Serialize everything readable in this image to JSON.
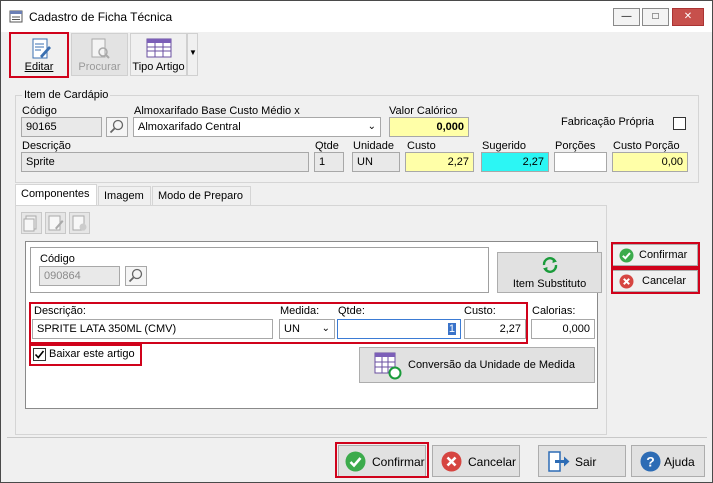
{
  "window": {
    "title": "Cadastro de Ficha Técnica"
  },
  "toolbar": {
    "edit_label": "Editar",
    "search_label": "Procurar",
    "type_label": "Tipo Artigo"
  },
  "item": {
    "group_title": "Item de Cardápio",
    "codigo_label": "Código",
    "codigo_value": "90165",
    "almox_label": "Almoxarifado Base Custo Médio x",
    "almox_value": "Almoxarifado Central",
    "valor_cal_label": "Valor Calórico",
    "valor_cal_value": "0,000",
    "fabricacao_label": "Fabricação Própria",
    "descricao_label": "Descrição",
    "descricao_value": "Sprite",
    "qtde_label": "Qtde",
    "qtde_value": "1",
    "unidade_label": "Unidade",
    "unidade_value": "UN",
    "custo_label": "Custo",
    "custo_value": "2,27",
    "sugerido_label": "Sugerido",
    "sugerido_value": "2,27",
    "porcoes_label": "Porções",
    "porcoes_value": "",
    "custo_porcao_label": "Custo Porção",
    "custo_porcao_value": "0,00"
  },
  "tabs": [
    "Componentes",
    "Imagem",
    "Modo de Preparo"
  ],
  "component": {
    "codigo_label": "Código",
    "codigo_value": "090864",
    "substituto_label": "Item Substituto",
    "descricao_label": "Descrição:",
    "descricao_value": "SPRITE LATA 350ML (CMV)",
    "medida_label": "Medida:",
    "medida_value": "UN",
    "qtde_label": "Qtde:",
    "qtde_value": "1",
    "custo_label": "Custo:",
    "custo_value": "2,27",
    "calorias_label": "Calorias:",
    "calorias_value": "0,000",
    "baixar_label": "Baixar este artigo",
    "conversao_label": "Conversão da Unidade de Medida"
  },
  "side": {
    "confirm_label": "Confirmar",
    "cancel_label": "Cancelar"
  },
  "bottom": {
    "confirm_label": "Confirmar",
    "cancel_label": "Cancelar",
    "exit_label": "Sair",
    "help_label": "Ajuda"
  }
}
